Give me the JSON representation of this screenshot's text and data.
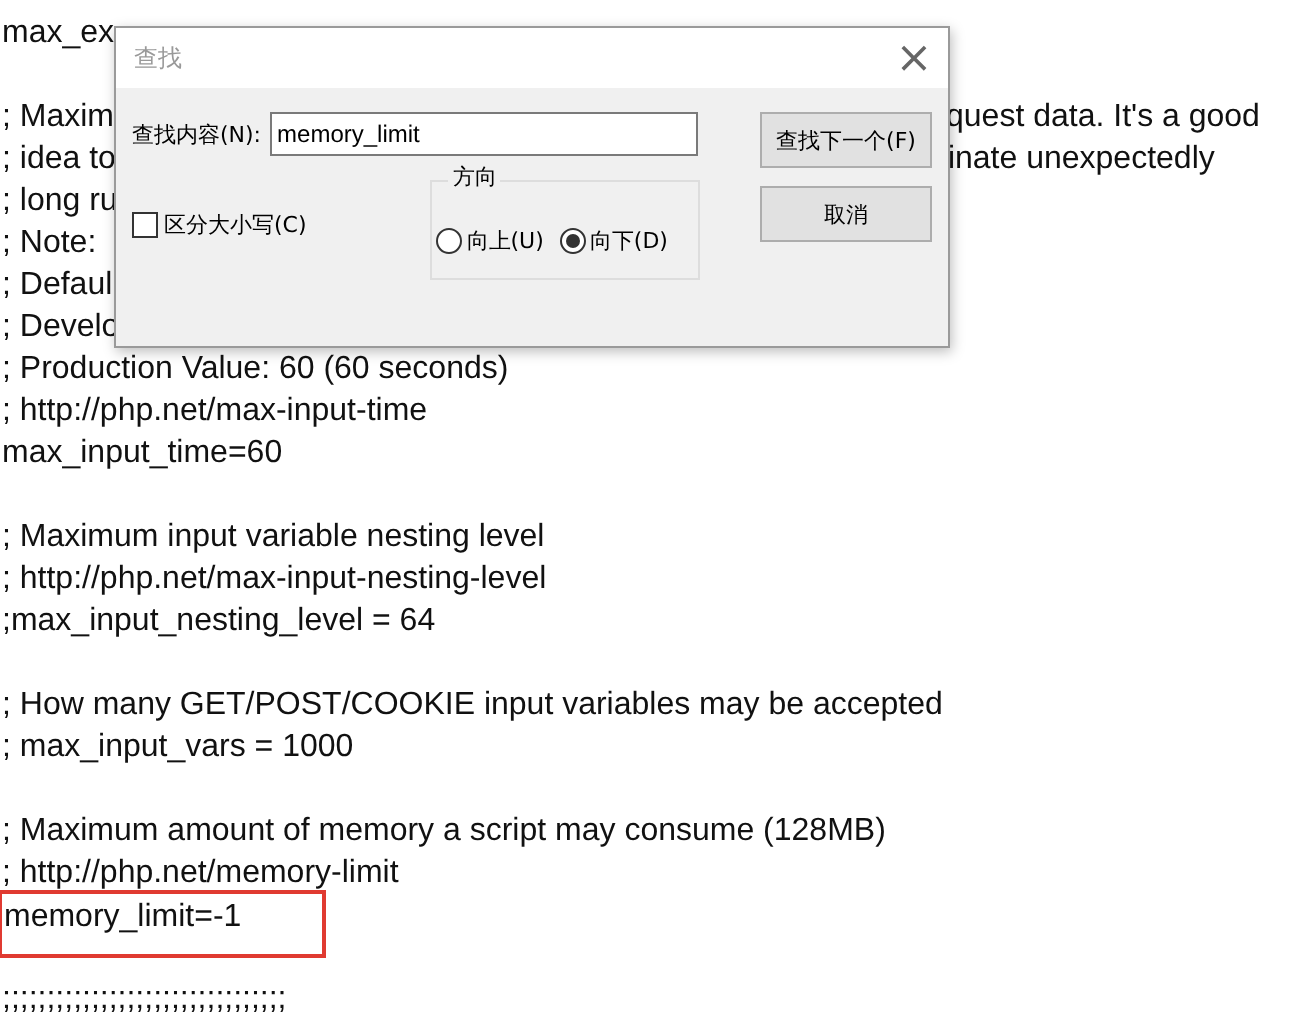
{
  "editor": {
    "blocks": [
      {
        "lines": [
          {
            "left": "max_ex"
          }
        ]
      },
      {
        "lines": [
          {
            "left": "; Maxim",
            "right": "quest data. It's a good"
          },
          {
            "left": "; idea to",
            "right": "inate unexpectedly"
          },
          {
            "left": "; long ru"
          },
          {
            "left": "; Note:"
          },
          {
            "left": "; Defaul"
          },
          {
            "left": "; Develo"
          },
          {
            "text": "; Production Value: 60 (60 seconds)"
          },
          {
            "text": "; http://php.net/max-input-time"
          },
          {
            "text": "max_input_time=60"
          }
        ]
      },
      {
        "lines": [
          {
            "text": "; Maximum input variable nesting level"
          },
          {
            "text": "; http://php.net/max-input-nesting-level"
          },
          {
            "text": ";max_input_nesting_level = 64"
          }
        ]
      },
      {
        "lines": [
          {
            "text": "; How many GET/POST/COOKIE input variables may be accepted"
          },
          {
            "text": "; max_input_vars = 1000"
          }
        ]
      },
      {
        "lines": [
          {
            "text": "; Maximum amount of memory a script may consume (128MB)"
          },
          {
            "text": "; http://php.net/memory-limit"
          },
          {
            "text": "memory_limit=-1",
            "highlighted": true
          }
        ]
      },
      {
        "lines": [
          {
            "text": ";;;;;;;;;;;;;;;;;;;;;;;;;;;;;;;;"
          }
        ]
      }
    ]
  },
  "dialog": {
    "title": "查找",
    "close": "×",
    "find_label": "查找内容(N):",
    "find_value": "memory_limit",
    "buttons": [
      "查找下一个(F)",
      "取消"
    ],
    "direction": {
      "title": "方向",
      "options": [
        {
          "label": "向上(U)",
          "selected": false
        },
        {
          "label": "向下(D)",
          "selected": true
        }
      ]
    },
    "match_case": {
      "label": "区分大小写(C)",
      "checked": false
    }
  }
}
